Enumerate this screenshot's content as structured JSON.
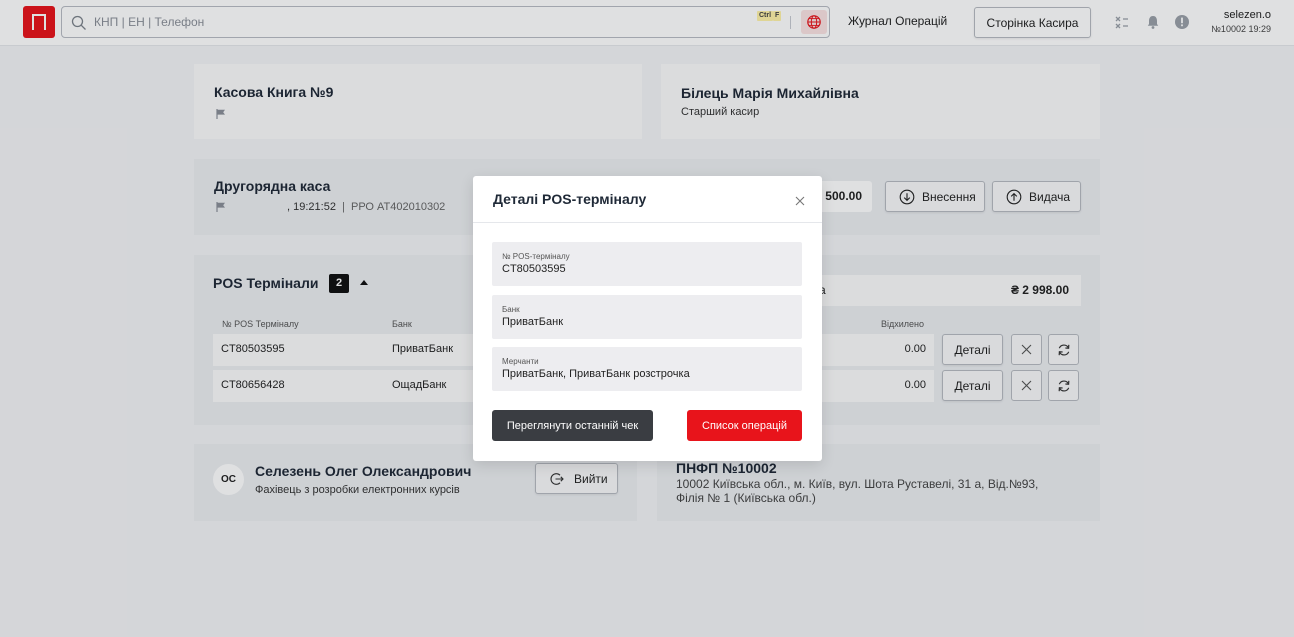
{
  "header": {
    "search_placeholder": "КНП | ЕН | Телефон",
    "kbd_ctrl": "Ctrl",
    "kbd_f": "F",
    "journal_link": "Журнал Операцій",
    "cashier_button": "Сторінка Касира",
    "username": "selezen.o",
    "user_meta": "№10002 19:29"
  },
  "cash_book": {
    "title": "Касова Книга №9"
  },
  "cashier": {
    "name": "Білець Марія Михайлівна",
    "role": "Старший касир"
  },
  "secondary_cash": {
    "title": "Другорядна каса",
    "time": ", 19:21:52",
    "separator": "|",
    "rro": "РРО АТ402010302",
    "amount": "500.00",
    "deposit_button": "Внесення",
    "withdraw_button": "Видача"
  },
  "pos": {
    "title": "POS Термінали",
    "count": "2",
    "columns": {
      "terminal": "№ POS Терміналу",
      "bank": "Банк",
      "rejected": "Відхилено"
    },
    "summary_label": "а",
    "summary_amount": "₴ 2 998.00",
    "rows": [
      {
        "terminal": "CT80503595",
        "bank": "ПриватБанк",
        "rejected": "0.00",
        "details": "Деталі"
      },
      {
        "terminal": "CT80656428",
        "bank": "ОщадБанк",
        "rejected": "0.00",
        "details": "Деталі"
      }
    ]
  },
  "employee": {
    "initials": "ОС",
    "name": "Селезень Олег Олександрович",
    "position": "Фахівець з розробки електронних курсів",
    "logout_button": "Вийти"
  },
  "branch": {
    "title": "ПНФП №10002",
    "address_line1": "10002 Київська обл., м. Київ, вул. Шота Руставелі, 31 а, Від.№93,",
    "address_line2": "Філія № 1 (Київська обл.)"
  },
  "modal": {
    "title": "Деталі POS-терміналу",
    "fields": [
      {
        "label": "№ POS-терміналу",
        "value": "CT80503595"
      },
      {
        "label": "Банк",
        "value": "ПриватБанк"
      },
      {
        "label": "Мерчанти",
        "value": "ПриватБанк, ПриватБанк розстрочка"
      }
    ],
    "view_receipt_button": "Переглянути останній чек",
    "operations_button": "Список операцій"
  },
  "colors": {
    "brand_red": "#e8141b",
    "dark_button": "#3a3d42"
  }
}
